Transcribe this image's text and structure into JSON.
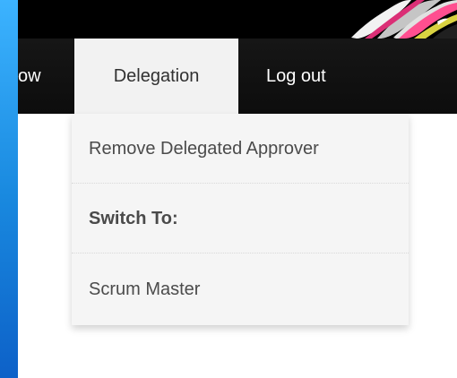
{
  "navigation": {
    "items": [
      {
        "label": "ow"
      },
      {
        "label": "Delegation"
      },
      {
        "label": "Log out"
      }
    ]
  },
  "dropdown": {
    "items": [
      {
        "label": "Remove Delegated Approver"
      },
      {
        "label": "Switch To:"
      },
      {
        "label": "Scrum Master"
      }
    ]
  },
  "colors": {
    "navbar": "#111111",
    "active_tab": "#f2f2f2",
    "dropdown": "#f5f5f5",
    "desktop": "#1a88d8"
  }
}
